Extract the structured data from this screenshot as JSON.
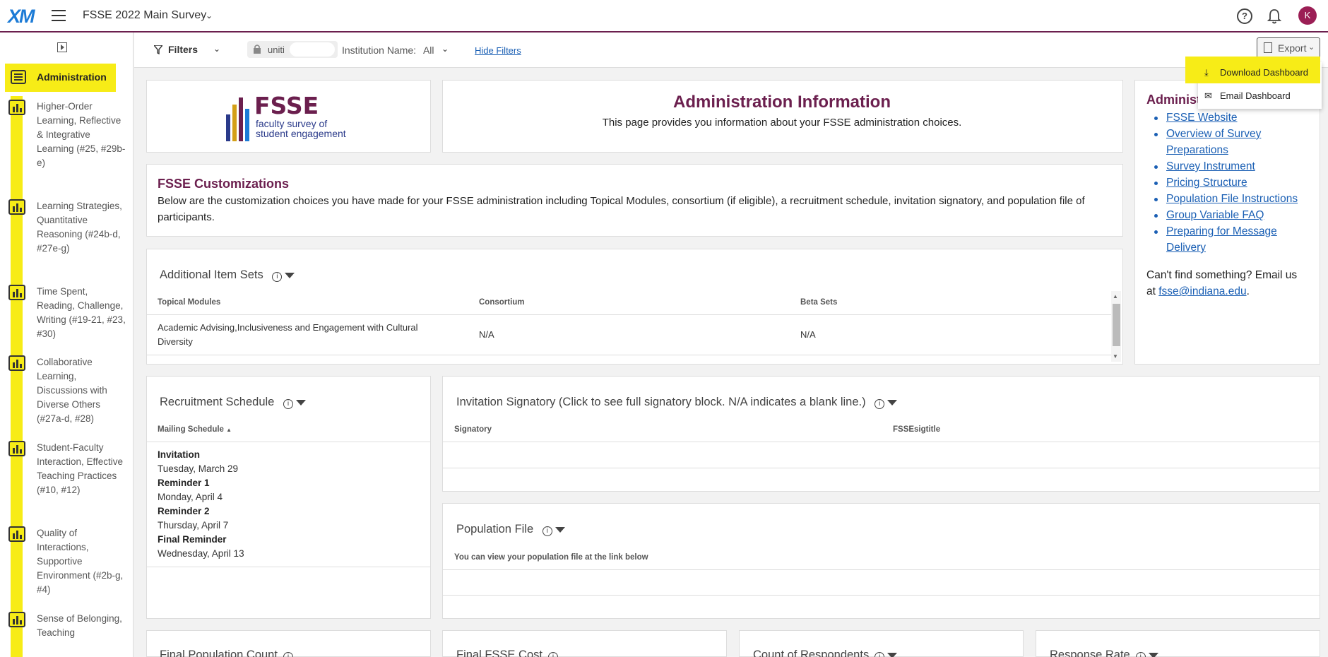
{
  "header": {
    "logo": "XM",
    "project_title": "FSSE 2022 Main Survey",
    "avatar_initial": "K"
  },
  "sidebar": {
    "active_item": "Administration",
    "items": [
      {
        "label": "Higher-Order Learning, Reflective & Integrative Learning (#25, #29b-e)"
      },
      {
        "label": "Learning Strategies, Quantitative Reasoning (#24b-d, #27e-g)"
      },
      {
        "label": "Time Spent, Reading, Challenge, Writing (#19-21, #23, #30)"
      },
      {
        "label": "Collaborative Learning, Discussions with Diverse Others (#27a-d, #28)"
      },
      {
        "label": "Student-Faculty Interaction, Effective Teaching Practices (#10, #12)"
      },
      {
        "label": "Quality of Interactions, Supportive Environment (#2b-g, #4)"
      },
      {
        "label": "Sense of Belonging, Teaching"
      }
    ]
  },
  "filterbar": {
    "filters_label": "Filters",
    "locked_filter": "uniti",
    "institution_label": "Institution Name:",
    "institution_value": "All",
    "hide_filters": "Hide Filters",
    "export_label": "Export"
  },
  "export_menu": {
    "download": "Download Dashboard",
    "email": "Email Dashboard"
  },
  "logo_card": {
    "wordmark": "FSSE",
    "subtitle_line1": "faculty survey of",
    "subtitle_line2": "student engagement"
  },
  "admin_info": {
    "title": "Administration Information",
    "subtitle": "This page provides you information about your FSSE administration choices."
  },
  "links_card": {
    "title": "Administ",
    "links": [
      "FSSE Website",
      "Overview of Survey Preparations",
      "Survey Instrument",
      "Pricing Structure",
      "Population File Instructions",
      "Group Variable FAQ",
      "Preparing for Message Delivery"
    ],
    "cant_find_text": "Can't find something? Email us at",
    "email": "fsse@indiana.edu",
    "period": "."
  },
  "customizations": {
    "title": "FSSE Customizations",
    "text": "Below are the customization choices you have made for your FSSE administration including Topical Modules, consortium (if eligible), a recruitment schedule, invitation signatory, and population file of participants."
  },
  "item_sets": {
    "title": "Additional Item Sets",
    "columns": [
      "Topical Modules",
      "Consortium",
      "Beta Sets"
    ],
    "rows": [
      [
        "Academic Advising,Inclusiveness and Engagement with Cultural Diversity",
        "N/A",
        "N/A"
      ]
    ]
  },
  "recruitment": {
    "title": "Recruitment Schedule",
    "column": "Mailing Schedule",
    "schedule": [
      {
        "label": "Invitation",
        "date": "Tuesday, March 29"
      },
      {
        "label": "Reminder 1",
        "date": "Monday, April 4"
      },
      {
        "label": "Reminder 2",
        "date": "Thursday, April 7"
      },
      {
        "label": "Final Reminder",
        "date": "Wednesday, April 13"
      }
    ]
  },
  "signatory": {
    "title": "Invitation Signatory (Click to see full signatory block. N/A indicates a blank line.)",
    "columns": [
      "Signatory",
      "FSSEsigtitle"
    ]
  },
  "population": {
    "title": "Population File",
    "column": "You can view your population file at the link below"
  },
  "bottom_cards": {
    "final_population": "Final Population Count",
    "final_cost": "Final FSSE Cost",
    "respondents": "Count of Respondents",
    "response_rate": "Response Rate"
  }
}
